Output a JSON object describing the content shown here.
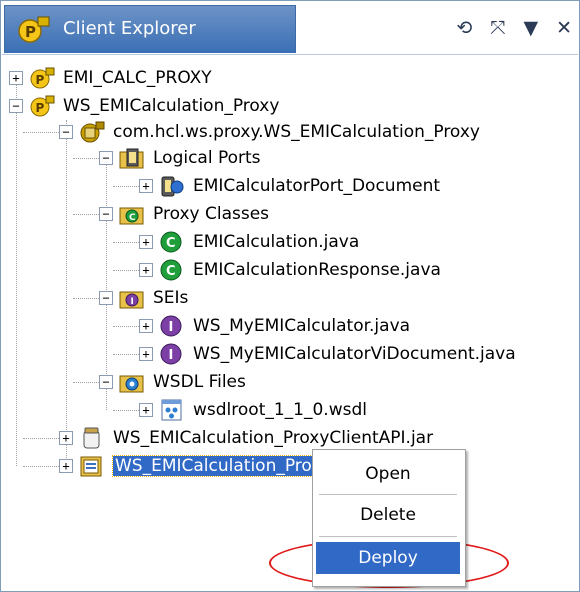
{
  "view": {
    "title": "Client Explorer",
    "actions": [
      {
        "name": "sync-icon",
        "glyph": "⟲"
      },
      {
        "name": "collapse-all-icon",
        "glyph": "⤧"
      },
      {
        "name": "view-menu-icon",
        "glyph": "▼"
      },
      {
        "name": "close-icon",
        "glyph": "✕"
      }
    ]
  },
  "tree": [
    {
      "label": "EMI_CALC_PROXY",
      "toggle": "+",
      "icon": "proxy-project-icon"
    },
    {
      "label": "WS_EMICalculation_Proxy",
      "toggle": "−",
      "icon": "proxy-project-icon"
    },
    {
      "label": "com.hcl.ws.proxy.WS_EMICalculation_Proxy",
      "toggle": "−",
      "icon": "package-icon"
    },
    {
      "label": "Logical Ports",
      "toggle": "−",
      "icon": "logical-ports-folder-icon"
    },
    {
      "label": "EMICalculatorPort_Document",
      "toggle": "+",
      "icon": "port-icon"
    },
    {
      "label": "Proxy Classes",
      "toggle": "−",
      "icon": "proxy-classes-folder-icon"
    },
    {
      "label": "EMICalculation.java",
      "toggle": "+",
      "icon": "class-icon"
    },
    {
      "label": "EMICalculationResponse.java",
      "toggle": "+",
      "icon": "class-icon"
    },
    {
      "label": "SEIs",
      "toggle": "−",
      "icon": "sei-folder-icon"
    },
    {
      "label": "WS_MyEMICalculator.java",
      "toggle": "+",
      "icon": "interface-icon"
    },
    {
      "label": "WS_MyEMICalculatorViDocument.java",
      "toggle": "+",
      "icon": "interface-icon"
    },
    {
      "label": "WSDL Files",
      "toggle": "−",
      "icon": "wsdl-folder-icon"
    },
    {
      "label": "wsdlroot_1_1_0.wsdl",
      "toggle": "+",
      "icon": "wsdl-file-icon"
    },
    {
      "label": "WS_EMICalculation_ProxyClientAPI.jar",
      "toggle": "+",
      "icon": "jar-icon"
    },
    {
      "label": "WS_EMICalculation_Proxy.ear",
      "toggle": "+",
      "icon": "ear-icon"
    }
  ],
  "context_menu": {
    "items": [
      "Open",
      "Delete",
      "Deploy"
    ],
    "active": "Deploy",
    "highlight_color": "#e01a1a"
  },
  "colors": {
    "selection": "#3169c6",
    "title_tab": "#3a6fb5"
  }
}
